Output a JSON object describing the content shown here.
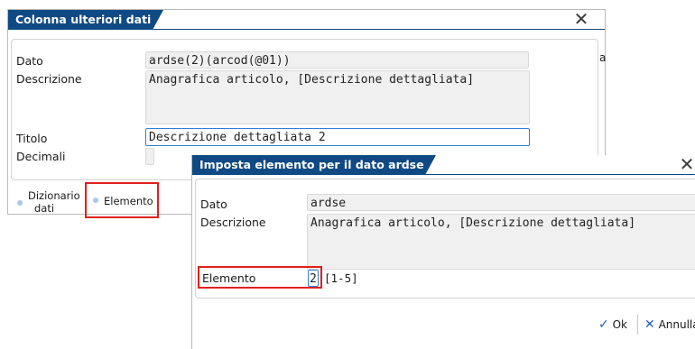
{
  "dialog1": {
    "title": "Colonna ulteriori dati",
    "close_glyph": "✕",
    "fields": {
      "dato_label": "Dato",
      "dato_value": "ardse(2)(arcod(@01))",
      "descrizione_label": "Descrizione",
      "descrizione_value": "Anagrafica articolo, [Descrizione dettagliata]",
      "titolo_label": "Titolo",
      "titolo_value": "Descrizione dettagliata 2",
      "decimali_label": "Decimali"
    },
    "bottom_tabs": {
      "dizionario_line1": "Dizionario",
      "dizionario_line2": "dati",
      "elemento": "Elemento"
    },
    "right_edge_glyph": "a"
  },
  "dialog2": {
    "title": "Imposta elemento per il dato ardse",
    "close_glyph": "✕",
    "fields": {
      "dato_label": "Dato",
      "dato_value": "ardse",
      "descrizione_label": "Descrizione",
      "descrizione_value": "Anagrafica articolo, [Descrizione dettagliata]",
      "elemento_label": "Elemento",
      "elemento_value": "2",
      "elemento_range": "[1-5]"
    },
    "footer": {
      "ok_label": "Ok",
      "annulla_label": "Annulla"
    }
  },
  "colors": {
    "title_bar": "#0f4a84",
    "highlight": "#e0201d",
    "field_bg": "#f0f0f0",
    "focus_border": "#2f7fd0"
  }
}
